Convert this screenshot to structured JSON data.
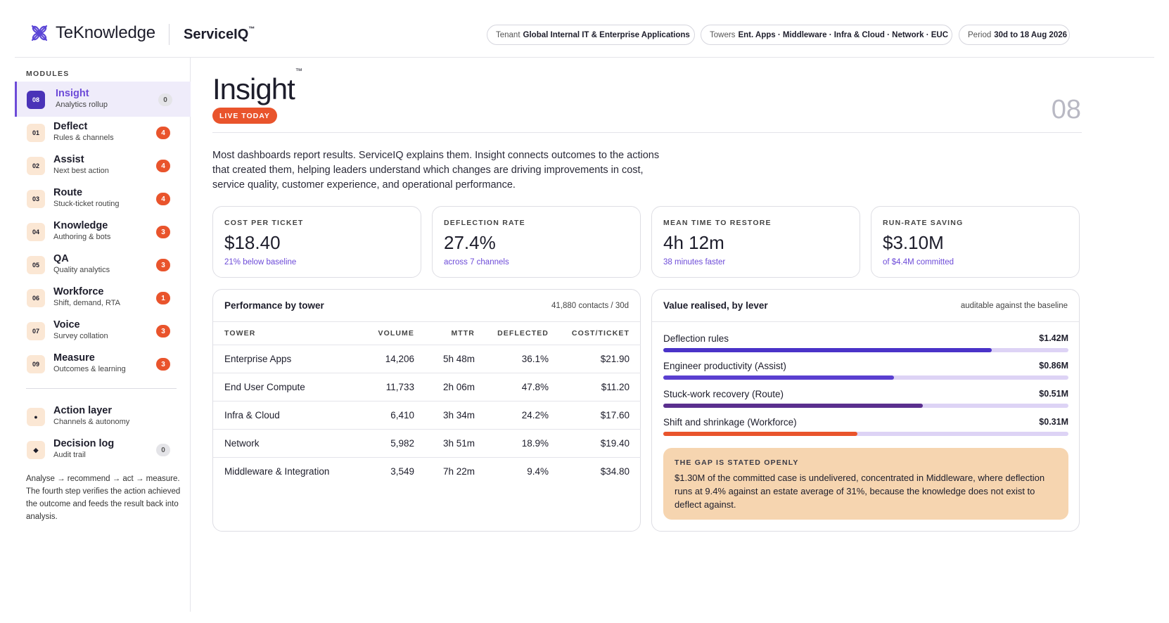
{
  "header": {
    "brand": "TeKnowledge",
    "product": "ServiceIQ",
    "product_tm": "™",
    "tenant_label": "Tenant",
    "tenant_value": "Global Internal IT & Enterprise Applications",
    "towers_label": "Towers",
    "towers_value": "Ent. Apps · Middleware · Infra & Cloud · Network · EUC",
    "period_label": "Period",
    "period_value": "30d to 18 Aug 2026"
  },
  "sidebar": {
    "heading": "MODULES",
    "items": [
      {
        "code": "08",
        "title": "Insight",
        "sub": "Analytics rollup",
        "count": "0",
        "active": true
      },
      {
        "code": "01",
        "title": "Deflect",
        "sub": "Rules & channels",
        "count": "4"
      },
      {
        "code": "02",
        "title": "Assist",
        "sub": "Next best action",
        "count": "4"
      },
      {
        "code": "03",
        "title": "Route",
        "sub": "Stuck-ticket routing",
        "count": "4"
      },
      {
        "code": "04",
        "title": "Knowledge",
        "sub": "Authoring & bots",
        "count": "3"
      },
      {
        "code": "05",
        "title": "QA",
        "sub": "Quality analytics",
        "count": "3"
      },
      {
        "code": "06",
        "title": "Workforce",
        "sub": "Shift, demand, RTA",
        "count": "1"
      },
      {
        "code": "07",
        "title": "Voice",
        "sub": "Survey collation",
        "count": "3"
      },
      {
        "code": "09",
        "title": "Measure",
        "sub": "Outcomes & learning",
        "count": "3"
      }
    ],
    "secondary": [
      {
        "glyph": "●",
        "title": "Action layer",
        "sub": "Channels & autonomy"
      },
      {
        "glyph": "◆",
        "title": "Decision log",
        "sub": "Audit trail",
        "count": "0"
      }
    ],
    "note": "Analyse → recommend → act → measure. The fourth step verifies the action achieved the outcome and feeds the result back into analysis."
  },
  "main": {
    "title": "Insight",
    "title_tm": "™",
    "live_badge": "LIVE TODAY",
    "page_number": "08",
    "intro": "Most dashboards report results. ServiceIQ explains them. Insight connects outcomes to the actions that created them, helping leaders understand which changes are driving improvements in cost, service quality, customer experience, and operational performance.",
    "kpis": [
      {
        "label": "COST PER TICKET",
        "value": "$18.40",
        "note": "21% below baseline"
      },
      {
        "label": "DEFLECTION RATE",
        "value": "27.4%",
        "note": "across 7 channels"
      },
      {
        "label": "MEAN TIME TO RESTORE",
        "value": "4h 12m",
        "note": "38 minutes faster"
      },
      {
        "label": "RUN-RATE SAVING",
        "value": "$3.10M",
        "note": "of $4.4M committed"
      }
    ],
    "tower_panel": {
      "title": "Performance by tower",
      "meta": "41,880 contacts / 30d",
      "columns": [
        "TOWER",
        "VOLUME",
        "MTTR",
        "DEFLECTED",
        "COST/TICKET"
      ],
      "rows": [
        [
          "Enterprise Apps",
          "14,206",
          "5h 48m",
          "36.1%",
          "$21.90"
        ],
        [
          "End User Compute",
          "11,733",
          "2h 06m",
          "47.8%",
          "$11.20"
        ],
        [
          "Infra & Cloud",
          "6,410",
          "3h 34m",
          "24.2%",
          "$17.60"
        ],
        [
          "Network",
          "5,982",
          "3h 51m",
          "18.9%",
          "$19.40"
        ],
        [
          "Middleware & Integration",
          "3,549",
          "7h 22m",
          "9.4%",
          "$34.80"
        ]
      ]
    },
    "value_panel": {
      "title": "Value realised, by lever",
      "meta": "auditable against the baseline",
      "levers": [
        {
          "label": "Deflection rules",
          "value": "$1.42M",
          "fill_fraction": 0.81,
          "color": "#4a33c8"
        },
        {
          "label": "Engineer productivity (Assist)",
          "value": "$0.86M",
          "fill_fraction": 0.57,
          "color": "#5a3fd0"
        },
        {
          "label": "Stuck-work recovery (Route)",
          "value": "$0.51M",
          "fill_fraction": 0.64,
          "color": "#5a2f8e"
        },
        {
          "label": "Shift and shrinkage (Workforce)",
          "value": "$0.31M",
          "fill_fraction": 0.48,
          "color": "#e9542c"
        }
      ],
      "gap_title": "THE GAP IS STATED OPENLY",
      "gap_text": "$1.30M of the committed case is undelivered, concentrated in Middleware, where deflection runs at 9.4% against an estate average of 31%, because the knowledge does not exist to deflect against."
    }
  },
  "colors": {
    "accent": "#6d4bd8",
    "orange": "#e9542c",
    "gap_bg": "#f6d5b0"
  }
}
